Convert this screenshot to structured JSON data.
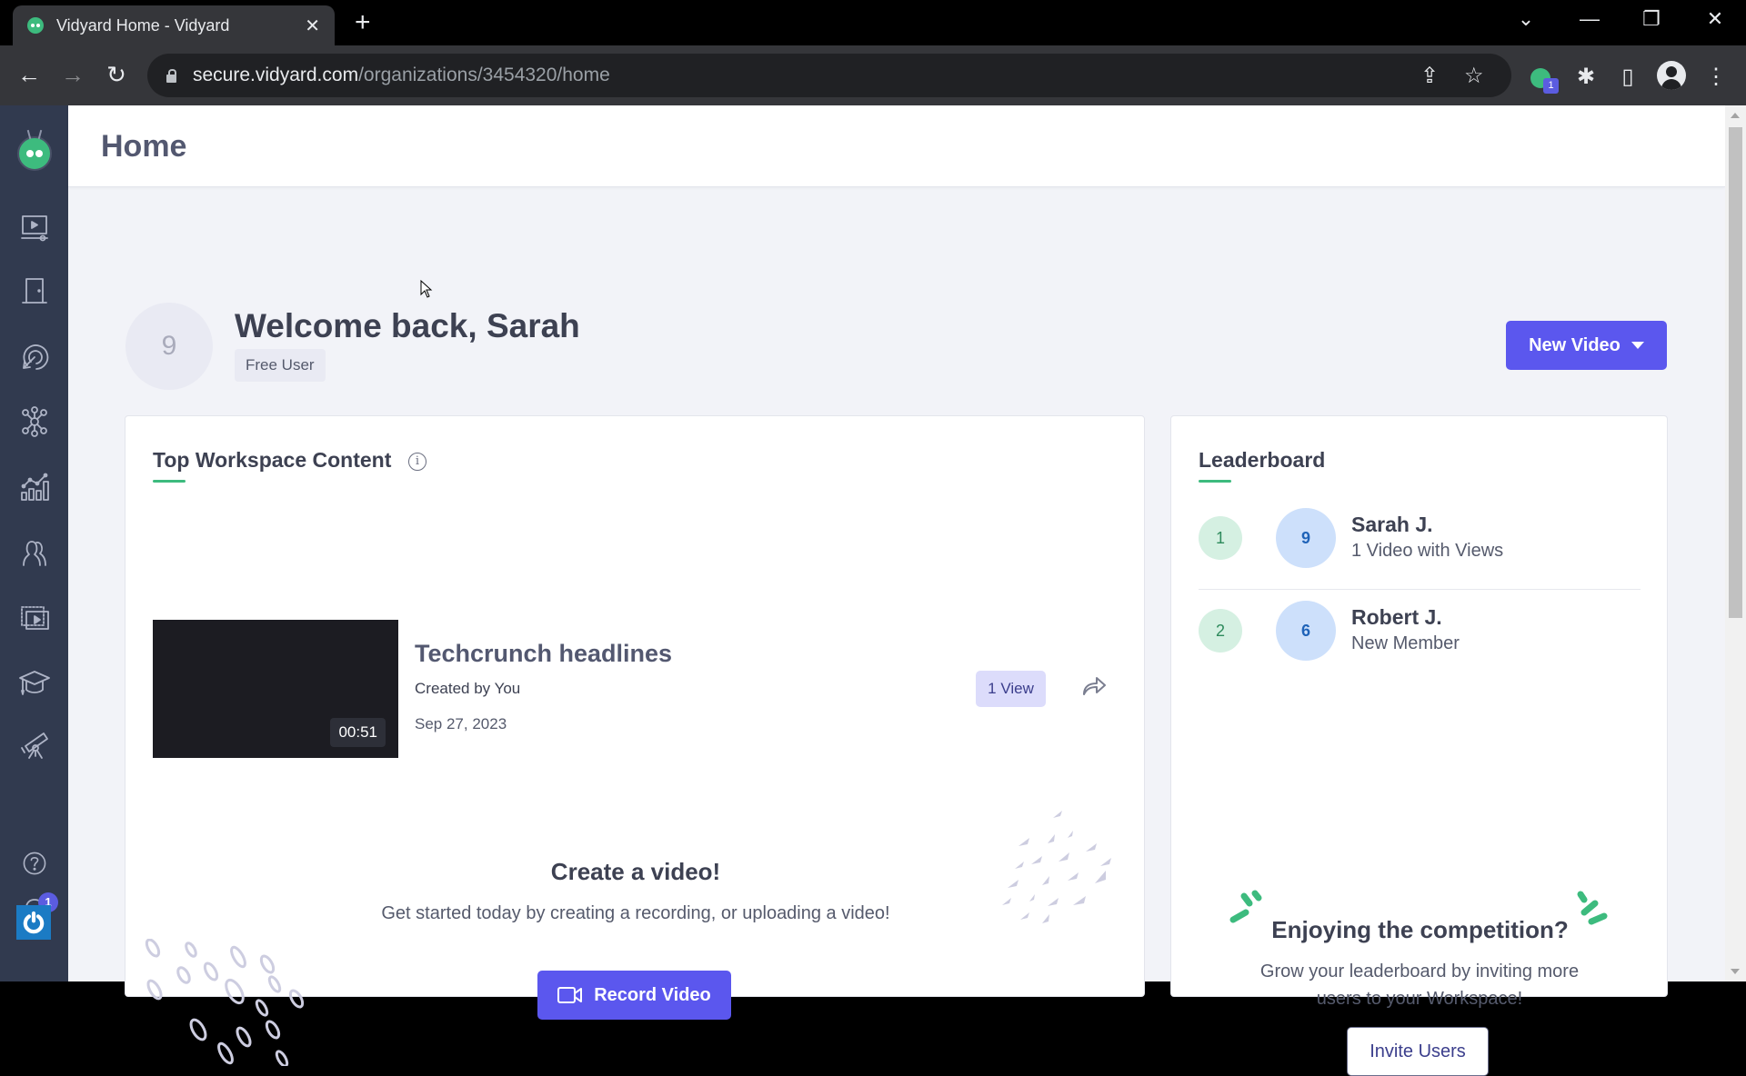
{
  "browser": {
    "tab_title": "Vidyard Home - Vidyard",
    "url_host": "secure.vidyard.com",
    "url_path": "/organizations/3454320/home",
    "extension_badge": "1"
  },
  "sidebar": {
    "items": [
      {
        "name": "videos",
        "icon": "video-library-icon"
      },
      {
        "name": "rooms",
        "icon": "door-icon"
      },
      {
        "name": "targeting",
        "icon": "target-cursor-icon"
      },
      {
        "name": "integrations",
        "icon": "network-hub-icon"
      },
      {
        "name": "analytics",
        "icon": "analytics-chart-icon"
      },
      {
        "name": "team",
        "icon": "users-icon"
      },
      {
        "name": "playlists",
        "icon": "video-collection-icon"
      },
      {
        "name": "learning",
        "icon": "graduation-cap-icon"
      },
      {
        "name": "discover",
        "icon": "telescope-icon"
      }
    ],
    "notifications_count": "1",
    "bottom": [
      {
        "name": "help",
        "icon": "help-icon"
      },
      {
        "name": "power",
        "icon": "power-icon"
      }
    ]
  },
  "header": {
    "title": "Home"
  },
  "welcome": {
    "avatar_initial": "9",
    "greeting": "Welcome back, Sarah",
    "plan": "Free User",
    "new_video_label": "New Video"
  },
  "top_content": {
    "title": "Top Workspace Content",
    "videos": [
      {
        "title": "Techcrunch headlines",
        "created_by": "Created by You",
        "date": "Sep 27, 2023",
        "duration": "00:51",
        "views": "1 View"
      }
    ],
    "create": {
      "title": "Create a video!",
      "description": "Get started today by creating a recording, or uploading a video!",
      "record_label": "Record Video"
    }
  },
  "leaderboard": {
    "title": "Leaderboard",
    "entries": [
      {
        "rank": "1",
        "avatar": "9",
        "name": "Sarah J.",
        "subtitle": "1 Video with Views"
      },
      {
        "rank": "2",
        "avatar": "6",
        "name": "Robert J.",
        "subtitle": "New Member"
      }
    ],
    "promo_title": "Enjoying the competition?",
    "promo_description": "Grow your leaderboard by inviting more users to your Workspace!",
    "invite_label": "Invite Users"
  },
  "colors": {
    "accent": "#5b57ee",
    "brand_green": "#3dbb7e",
    "sidebar_bg": "#313a4f"
  }
}
